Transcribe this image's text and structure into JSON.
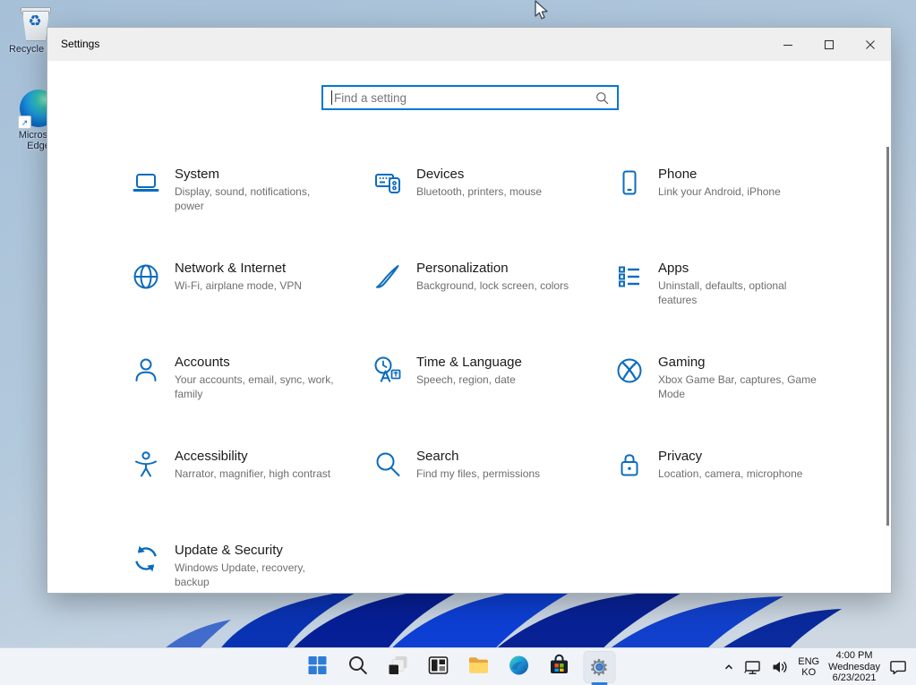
{
  "desktop": {
    "icons": [
      {
        "label": "Recycle Bin"
      },
      {
        "label": "Microsoft Edge"
      }
    ]
  },
  "window": {
    "title": "Settings"
  },
  "search": {
    "placeholder": "Find a setting"
  },
  "categories": [
    {
      "name": "System",
      "desc": "Display, sound, notifications, power",
      "icon": "laptop"
    },
    {
      "name": "Devices",
      "desc": "Bluetooth, printers, mouse",
      "icon": "devices"
    },
    {
      "name": "Phone",
      "desc": "Link your Android, iPhone",
      "icon": "phone"
    },
    {
      "name": "Network & Internet",
      "desc": "Wi-Fi, airplane mode, VPN",
      "icon": "globe"
    },
    {
      "name": "Personalization",
      "desc": "Background, lock screen, colors",
      "icon": "brush"
    },
    {
      "name": "Apps",
      "desc": "Uninstall, defaults, optional features",
      "icon": "apps"
    },
    {
      "name": "Accounts",
      "desc": "Your accounts, email, sync, work, family",
      "icon": "person"
    },
    {
      "name": "Time & Language",
      "desc": "Speech, region, date",
      "icon": "clocklang"
    },
    {
      "name": "Gaming",
      "desc": "Xbox Game Bar, captures, Game Mode",
      "icon": "xbox"
    },
    {
      "name": "Accessibility",
      "desc": "Narrator, magnifier, high contrast",
      "icon": "access"
    },
    {
      "name": "Search",
      "desc": "Find my files, permissions",
      "icon": "magnifier"
    },
    {
      "name": "Privacy",
      "desc": "Location, camera, microphone",
      "icon": "lock"
    },
    {
      "name": "Update & Security",
      "desc": "Windows Update, recovery, backup",
      "icon": "sync"
    }
  ],
  "taskbar": {
    "items": [
      {
        "name": "start",
        "icon": "tb-start"
      },
      {
        "name": "search",
        "icon": "tb-search"
      },
      {
        "name": "task-view",
        "icon": "tb-taskview"
      },
      {
        "name": "widgets",
        "icon": "tb-widgets"
      },
      {
        "name": "file-explorer",
        "icon": "tb-explorer"
      },
      {
        "name": "edge",
        "icon": "tb-edge"
      },
      {
        "name": "microsoft-store",
        "icon": "tb-store"
      },
      {
        "name": "settings",
        "icon": "tb-settings",
        "active": true
      }
    ],
    "tray": {
      "language_primary": "ENG",
      "language_secondary": "KO",
      "time": "4:00 PM",
      "weekday": "Wednesday",
      "date": "6/23/2021"
    }
  },
  "colors": {
    "category_icon_blue": "#0b6cbd",
    "search_border_blue": "#0078d7",
    "taskbar_accent_blue": "#2e7cd6",
    "bloom_dark_blue": "#0a33b4",
    "titlebar_gray": "#efefef"
  }
}
